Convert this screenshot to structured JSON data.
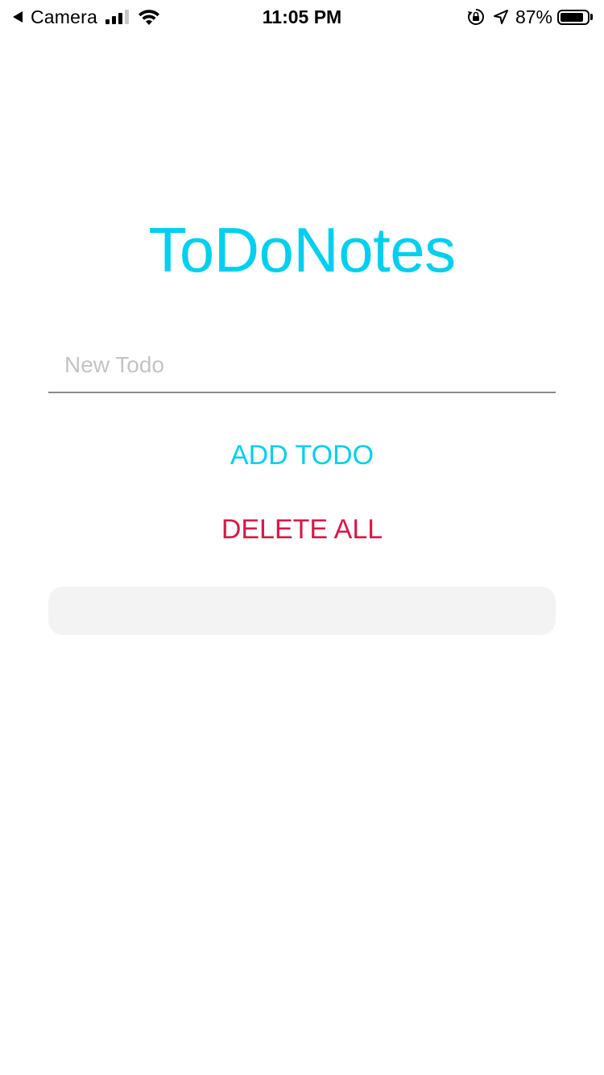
{
  "status_bar": {
    "back_app": "Camera",
    "time": "11:05 PM",
    "battery_percent": "87%",
    "battery_level": 0.87,
    "signal_bars_active": 3,
    "signal_bars_total": 4
  },
  "app": {
    "title": "ToDoNotes",
    "input": {
      "placeholder": "New Todo",
      "value": ""
    },
    "add_button_label": "ADD TODO",
    "delete_button_label": "DELETE ALL",
    "todos": []
  },
  "colors": {
    "accent": "#00cff0",
    "danger": "#d61a48",
    "list_bg": "#f3f3f3",
    "placeholder": "#c4c4c4"
  }
}
